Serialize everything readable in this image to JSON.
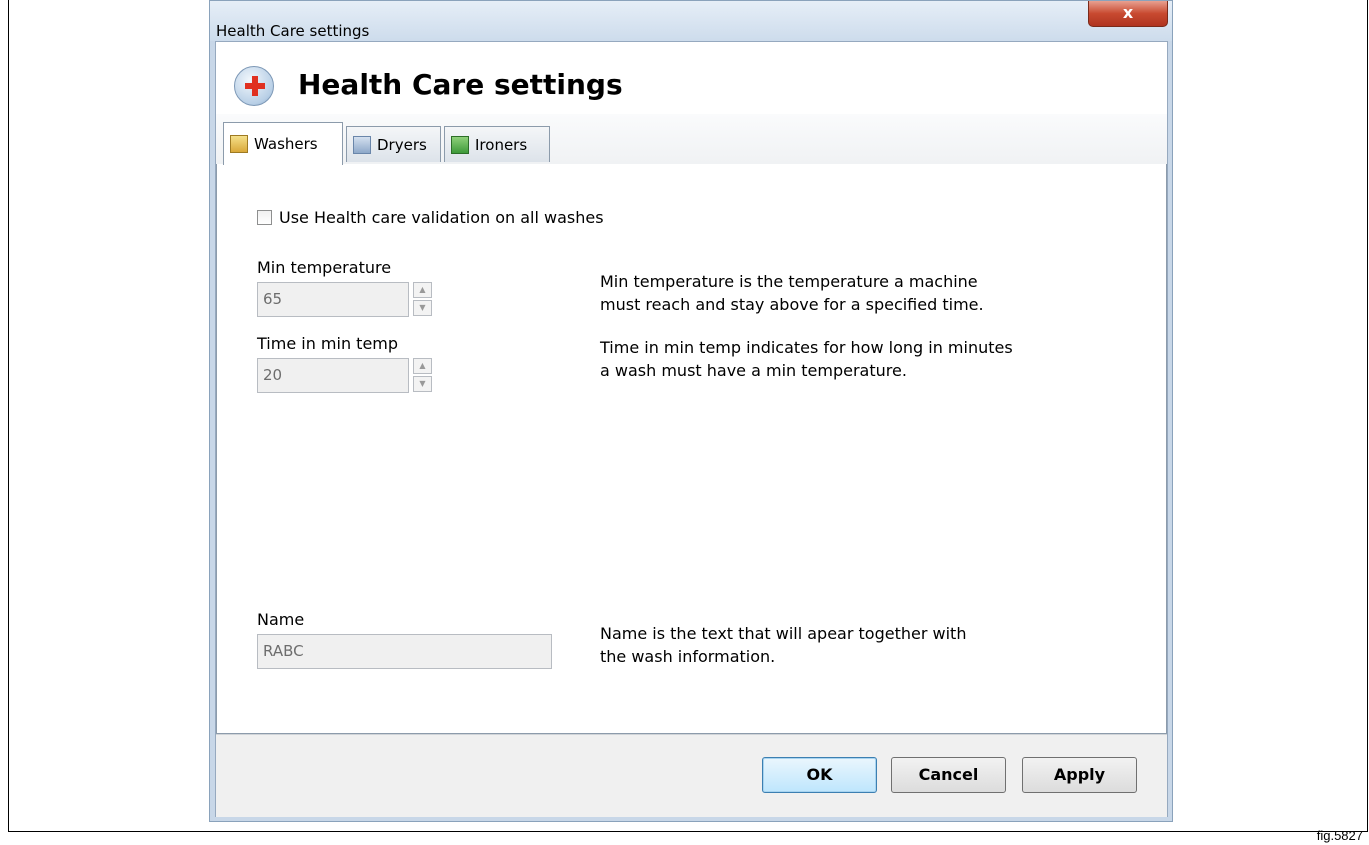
{
  "window": {
    "title": "Health Care settings",
    "close_label": "x"
  },
  "header": {
    "title": "Health Care settings",
    "icon": "health-care-cross-icon"
  },
  "tabs": [
    {
      "label": "Washers",
      "icon": "washer-icon",
      "active": true
    },
    {
      "label": "Dryers",
      "icon": "dryer-icon",
      "active": false
    },
    {
      "label": "Ironers",
      "icon": "ironer-icon",
      "active": false
    }
  ],
  "washers": {
    "validation_checkbox": {
      "label": "Use Health care validation on all washes",
      "checked": false
    },
    "min_temperature": {
      "label": "Min temperature",
      "value": "65",
      "help": [
        "Min temperature is the temperature a machine",
        "must reach and stay above for a specified time."
      ]
    },
    "time_in_min_temp": {
      "label": "Time in min temp",
      "value": "20",
      "help": [
        "Time in min temp indicates for how long in minutes",
        "a wash must have a min temperature."
      ]
    },
    "name": {
      "label": "Name",
      "value": "RABC",
      "help": [
        "Name is the text that will apear together with",
        "the wash information."
      ]
    }
  },
  "buttons": {
    "ok": "OK",
    "cancel": "Cancel",
    "apply": "Apply"
  },
  "figure_label": "fig.5827"
}
